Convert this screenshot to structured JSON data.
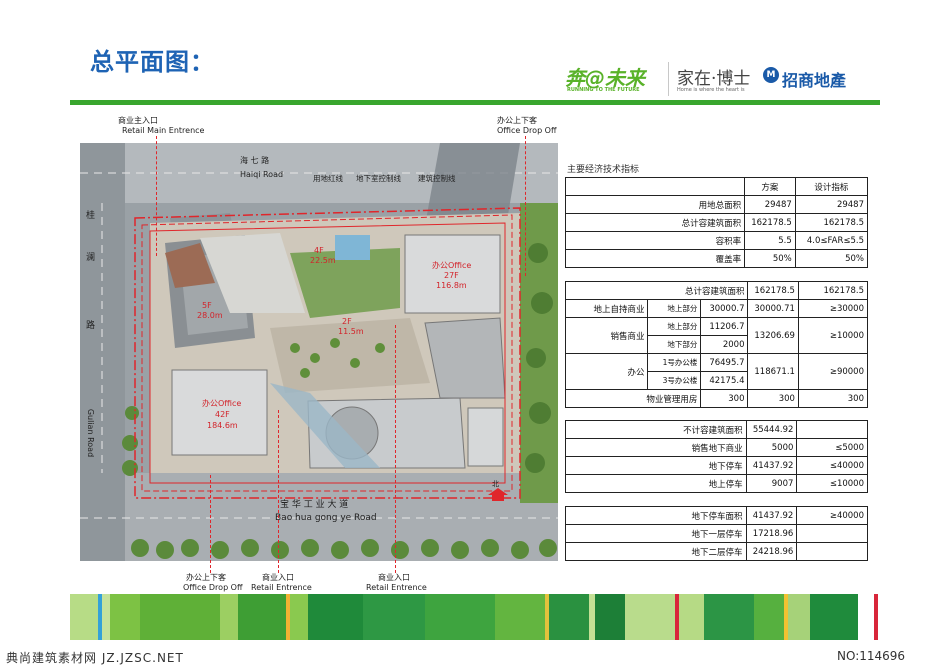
{
  "title": "总平面图：",
  "logos": {
    "running_cn": "奔@未来",
    "running_en": "RUNNING TO THE FUTURE",
    "home_cn": "家在·博士",
    "home_en": "Home is where the heart is",
    "cmp": "招商地產",
    "cmp_mark": "M"
  },
  "site_plan": {
    "labels": {
      "retail_main_cn": "商业主入口",
      "retail_main_en": "Retail Main Entrence",
      "office_drop_top_cn": "办公上下客",
      "office_drop_top_en": "Office Drop Off",
      "haiqi_cn": "海  七  路",
      "haiqi_en": "Haiqi Road",
      "redline": "用地红线",
      "basement_line": "地下室控制线",
      "building_line": "建筑控制线",
      "gui": "桂",
      "lan": "澜",
      "lu": "路",
      "gulian_en": "Gulian Road",
      "b4f": "4F",
      "b4f_h": "22.5m",
      "b5f": "5F",
      "b5f_h": "28.0m",
      "b2f": "2F",
      "b2f_h": "11.5m",
      "office27": "办公Office",
      "office27_f": "27F",
      "office27_h": "116.8m",
      "office42": "办公Office",
      "office42_f": "42F",
      "office42_h": "184.6m",
      "baohua_cn": "宝  华  工  业  大  道",
      "baohua_en": "Bao hua gong ye Road",
      "north": "北",
      "office_drop_bottom_cn": "办公上下客",
      "office_drop_bottom_en": "Office Drop Off",
      "retail_ent1_cn": "商业入口",
      "retail_ent1_en": "Retail Entrence",
      "retail_ent2_cn": "商业入口",
      "retail_ent2_en": "Retail Entrence"
    }
  },
  "indicators": {
    "title": "主要经济技术指标",
    "header": {
      "col_scheme": "方案",
      "col_design": "设计指标"
    },
    "table1": [
      {
        "label": "用地总面积",
        "scheme": "29487",
        "design": "29487"
      },
      {
        "label": "总计容建筑面积",
        "scheme": "162178.5",
        "design": "162178.5"
      },
      {
        "label": "容积率",
        "scheme": "5.5",
        "design": "4.0≤FAR≤5.5"
      },
      {
        "label": "覆盖率",
        "scheme": "50%",
        "design": "50%"
      }
    ],
    "table2": {
      "total_label": "总计容建筑面积",
      "total_scheme": "162178.5",
      "total_design": "162178.5",
      "self_label": "地上自持商业",
      "self_sub": "地上部分",
      "self_value": "30000.7",
      "self_scheme": "30000.71",
      "self_design": "≥30000",
      "sale_label": "销售商业",
      "sale_sub1": "地上部分",
      "sale_val1": "11206.7",
      "sale_sub2": "地下部分",
      "sale_val2": "2000",
      "sale_scheme": "13206.69",
      "sale_design": "≥10000",
      "office_label": "办公",
      "office_sub1": "1号办公楼",
      "office_val1": "76495.7",
      "office_sub2": "3号办公楼",
      "office_val2": "42175.4",
      "office_scheme": "118671.1",
      "office_design": "≥90000",
      "prop_label": "物业管理用房",
      "prop_value": "300",
      "prop_scheme": "300",
      "prop_design": "300"
    },
    "table3": [
      {
        "label": "不计容建筑面积",
        "scheme": "55444.92",
        "design": ""
      },
      {
        "label": "销售地下商业",
        "scheme": "5000",
        "design": "≤5000"
      },
      {
        "label": "地下停车",
        "scheme": "41437.92",
        "design": "≤40000"
      },
      {
        "label": "地上停车",
        "scheme": "9007",
        "design": "≤10000"
      }
    ],
    "table4": [
      {
        "label": "地下停车面积",
        "scheme": "41437.92",
        "design": "≥40000"
      },
      {
        "label": "地下一层停车",
        "scheme": "17218.96",
        "design": ""
      },
      {
        "label": "地下二层停车",
        "scheme": "24218.96",
        "design": ""
      }
    ]
  },
  "colors": {
    "title_blue": "#1e63b4",
    "rule_green": "#39a62e",
    "redline": "#e0262b"
  },
  "footer": {
    "left": "典尚建筑素材网 JZ.JZSC.NET",
    "right": "NO:114696"
  }
}
